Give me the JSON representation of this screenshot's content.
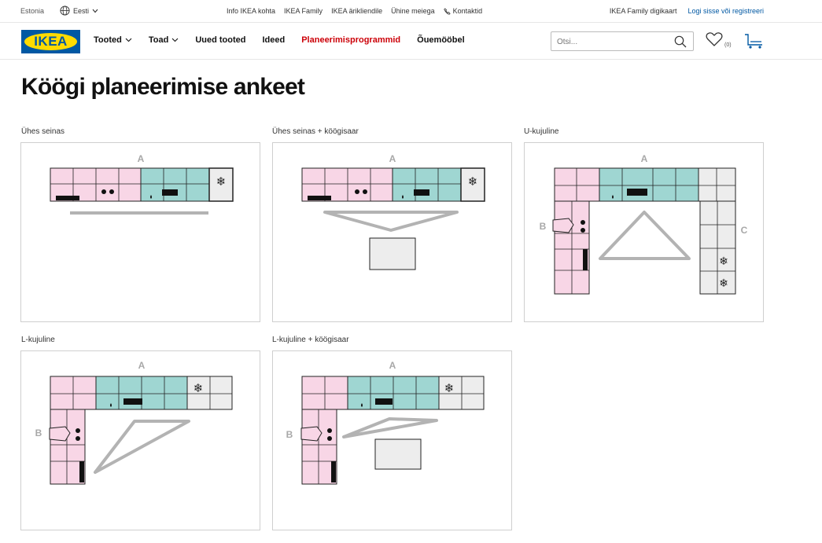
{
  "topbar": {
    "country": "Estonia",
    "language": "Eesti",
    "links": [
      "Info IKEA kohta",
      "IKEA Family",
      "IKEA ärikliendile",
      "Ühine meiega"
    ],
    "contact": "Kontaktid",
    "family_card": "IKEA Family digikaart",
    "login": "Logi sisse või registreeri"
  },
  "nav": {
    "logo": "IKEA",
    "menu": [
      {
        "label": "Tooted",
        "dropdown": true
      },
      {
        "label": "Toad",
        "dropdown": true
      },
      {
        "label": "Uued tooted",
        "dropdown": false
      },
      {
        "label": "Ideed",
        "dropdown": false
      },
      {
        "label": "Planeerimisprogrammid",
        "dropdown": false,
        "highlight": true
      },
      {
        "label": "Õuemööbel",
        "dropdown": false
      }
    ],
    "search_placeholder": "Otsi...",
    "wishlist_count": "(0)"
  },
  "page": {
    "title": "Köögi planeerimise ankeet"
  },
  "layouts": [
    {
      "label": "Ühes seinas",
      "letters": [
        "A"
      ]
    },
    {
      "label": "Ühes seinas + köögisaar",
      "letters": [
        "A"
      ]
    },
    {
      "label": "U-kujuline",
      "letters": [
        "A",
        "B",
        "C"
      ]
    },
    {
      "label": "L-kujuline",
      "letters": [
        "A",
        "B"
      ]
    },
    {
      "label": "L-kujuline + köögisaar",
      "letters": [
        "A",
        "B"
      ]
    }
  ],
  "colors": {
    "pink": "#f8d6e6",
    "teal": "#9fd6d2",
    "grey_cabinet": "#ededed",
    "triangle": "#b3b3b3",
    "letter": "#a8a8a8",
    "ikea_blue": "#0058a3",
    "ikea_yellow": "#ffdb00",
    "highlight_red": "#cc0008"
  }
}
